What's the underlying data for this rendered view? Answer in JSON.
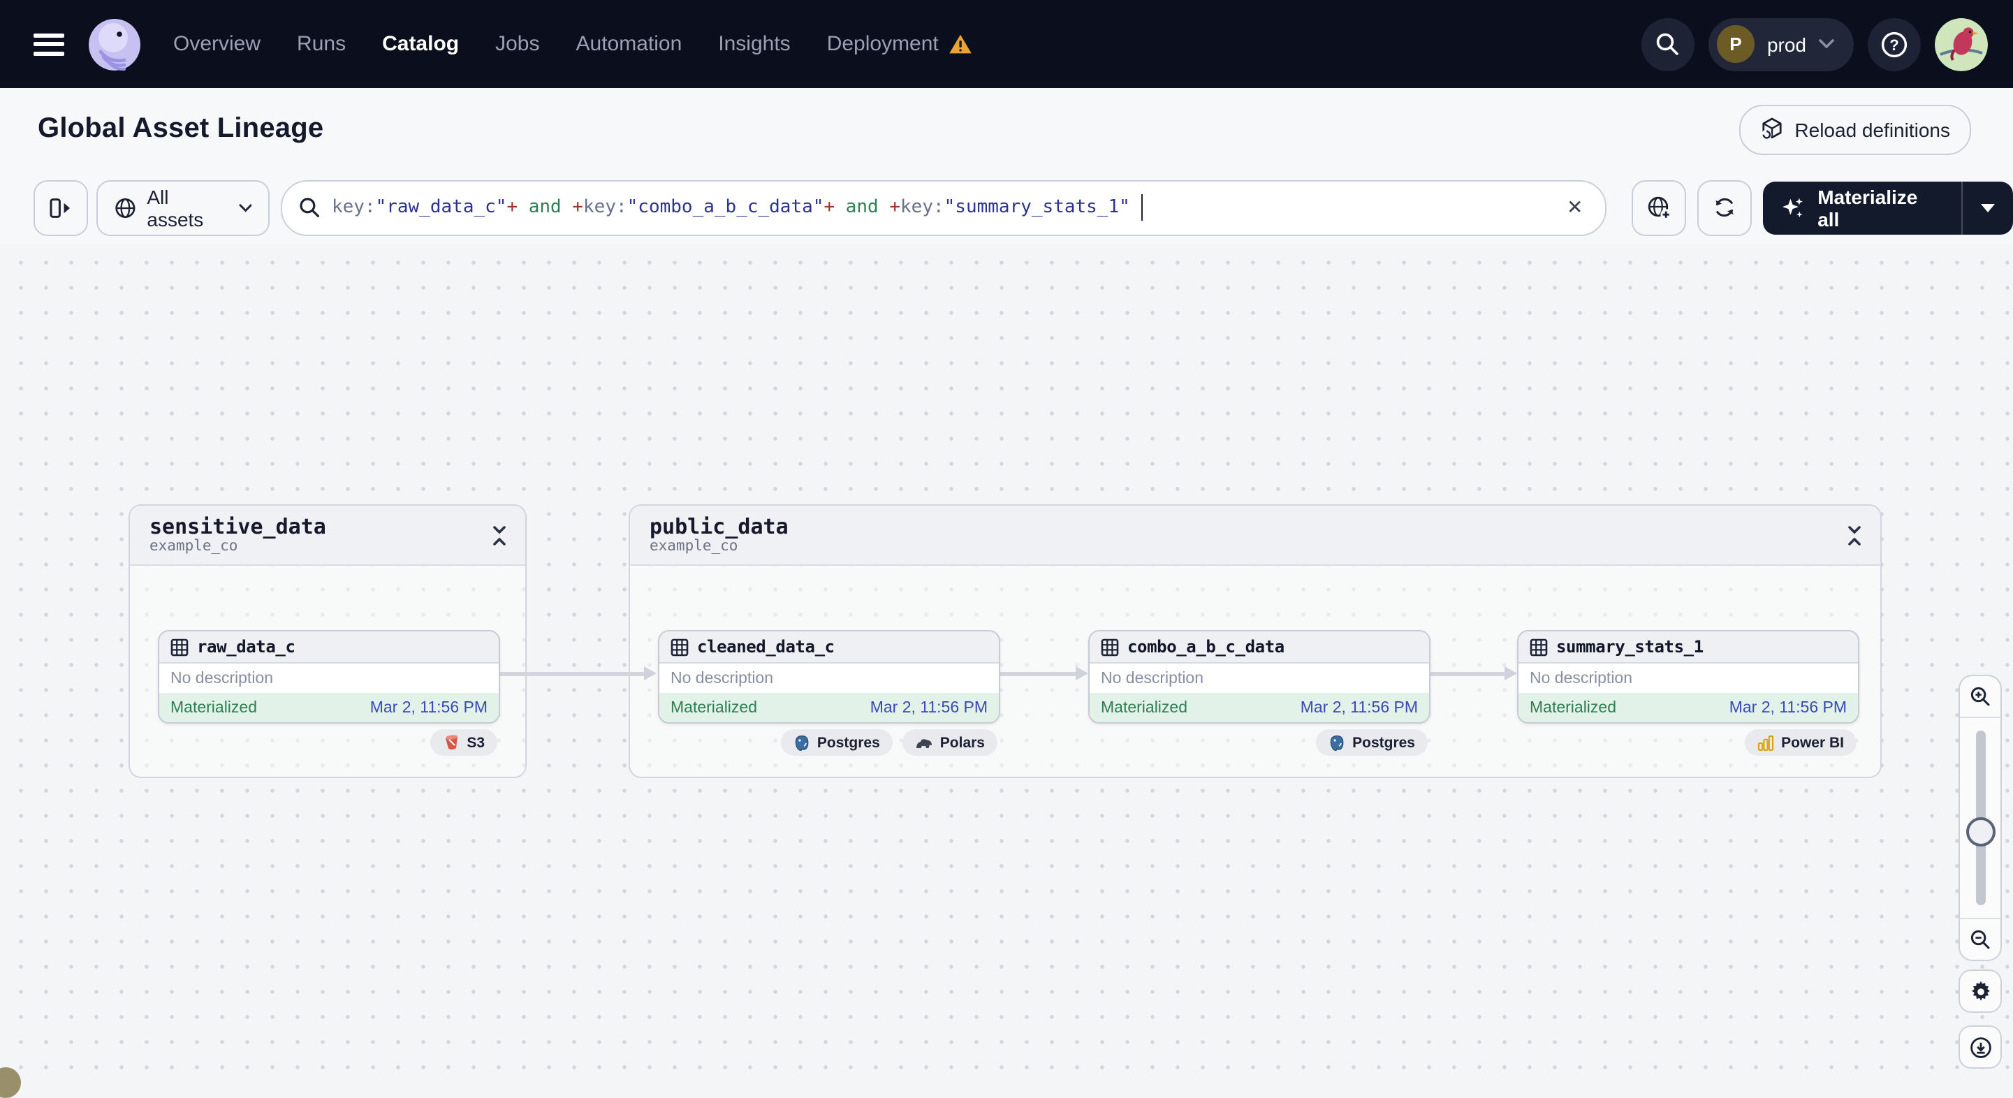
{
  "nav": {
    "items": [
      {
        "label": "Overview"
      },
      {
        "label": "Runs"
      },
      {
        "label": "Catalog",
        "active": true
      },
      {
        "label": "Jobs"
      },
      {
        "label": "Automation"
      },
      {
        "label": "Insights"
      },
      {
        "label": "Deployment",
        "warning": true
      }
    ],
    "environment": {
      "initial": "P",
      "name": "prod"
    }
  },
  "header": {
    "title": "Global Asset Lineage",
    "reload_label": "Reload definitions"
  },
  "toolbar": {
    "scope_label": "All assets",
    "materialize_label": "Materialize all",
    "clear_label": "✕",
    "query": [
      {
        "text": "key:",
        "type": "key"
      },
      {
        "text": "\"raw_data_c\"",
        "type": "value"
      },
      {
        "text": "+",
        "type": "plus"
      },
      {
        "text": " and ",
        "type": "op"
      },
      {
        "text": "+",
        "type": "plus"
      },
      {
        "text": "key:",
        "type": "key"
      },
      {
        "text": "\"combo_a_b_c_data\"",
        "type": "value"
      },
      {
        "text": "+",
        "type": "plus"
      },
      {
        "text": " and ",
        "type": "op"
      },
      {
        "text": "+",
        "type": "plus"
      },
      {
        "text": "key:",
        "type": "key"
      },
      {
        "text": "\"summary_stats_1\"",
        "type": "value"
      }
    ]
  },
  "graph": {
    "groups": [
      {
        "name": "sensitive_data",
        "location": "example_co"
      },
      {
        "name": "public_data",
        "location": "example_co"
      }
    ],
    "nodes": [
      {
        "name": "raw_data_c",
        "description": "No description",
        "status": "Materialized",
        "timestamp": "Mar 2, 11:56 PM",
        "tags": [
          {
            "label": "S3",
            "icon": "s3"
          }
        ]
      },
      {
        "name": "cleaned_data_c",
        "description": "No description",
        "status": "Materialized",
        "timestamp": "Mar 2, 11:56 PM",
        "tags": [
          {
            "label": "Postgres",
            "icon": "postgres"
          },
          {
            "label": "Polars",
            "icon": "polars"
          }
        ]
      },
      {
        "name": "combo_a_b_c_data",
        "description": "No description",
        "status": "Materialized",
        "timestamp": "Mar 2, 11:56 PM",
        "tags": [
          {
            "label": "Postgres",
            "icon": "postgres"
          }
        ]
      },
      {
        "name": "summary_stats_1",
        "description": "No description",
        "status": "Materialized",
        "timestamp": "Mar 2, 11:56 PM",
        "tags": [
          {
            "label": "Power BI",
            "icon": "powerbi"
          }
        ]
      }
    ]
  },
  "colors": {
    "nav_bg": "#0b0e1d",
    "brand_lavender": "#c9c3f2",
    "materialized_green": "#2f7d51",
    "timestamp_indigo": "#3a49b5",
    "warning_orange": "#eba23a",
    "query_value": "#2c3390",
    "query_operator_green": "#2e8052",
    "query_plus_red": "#99372e"
  }
}
